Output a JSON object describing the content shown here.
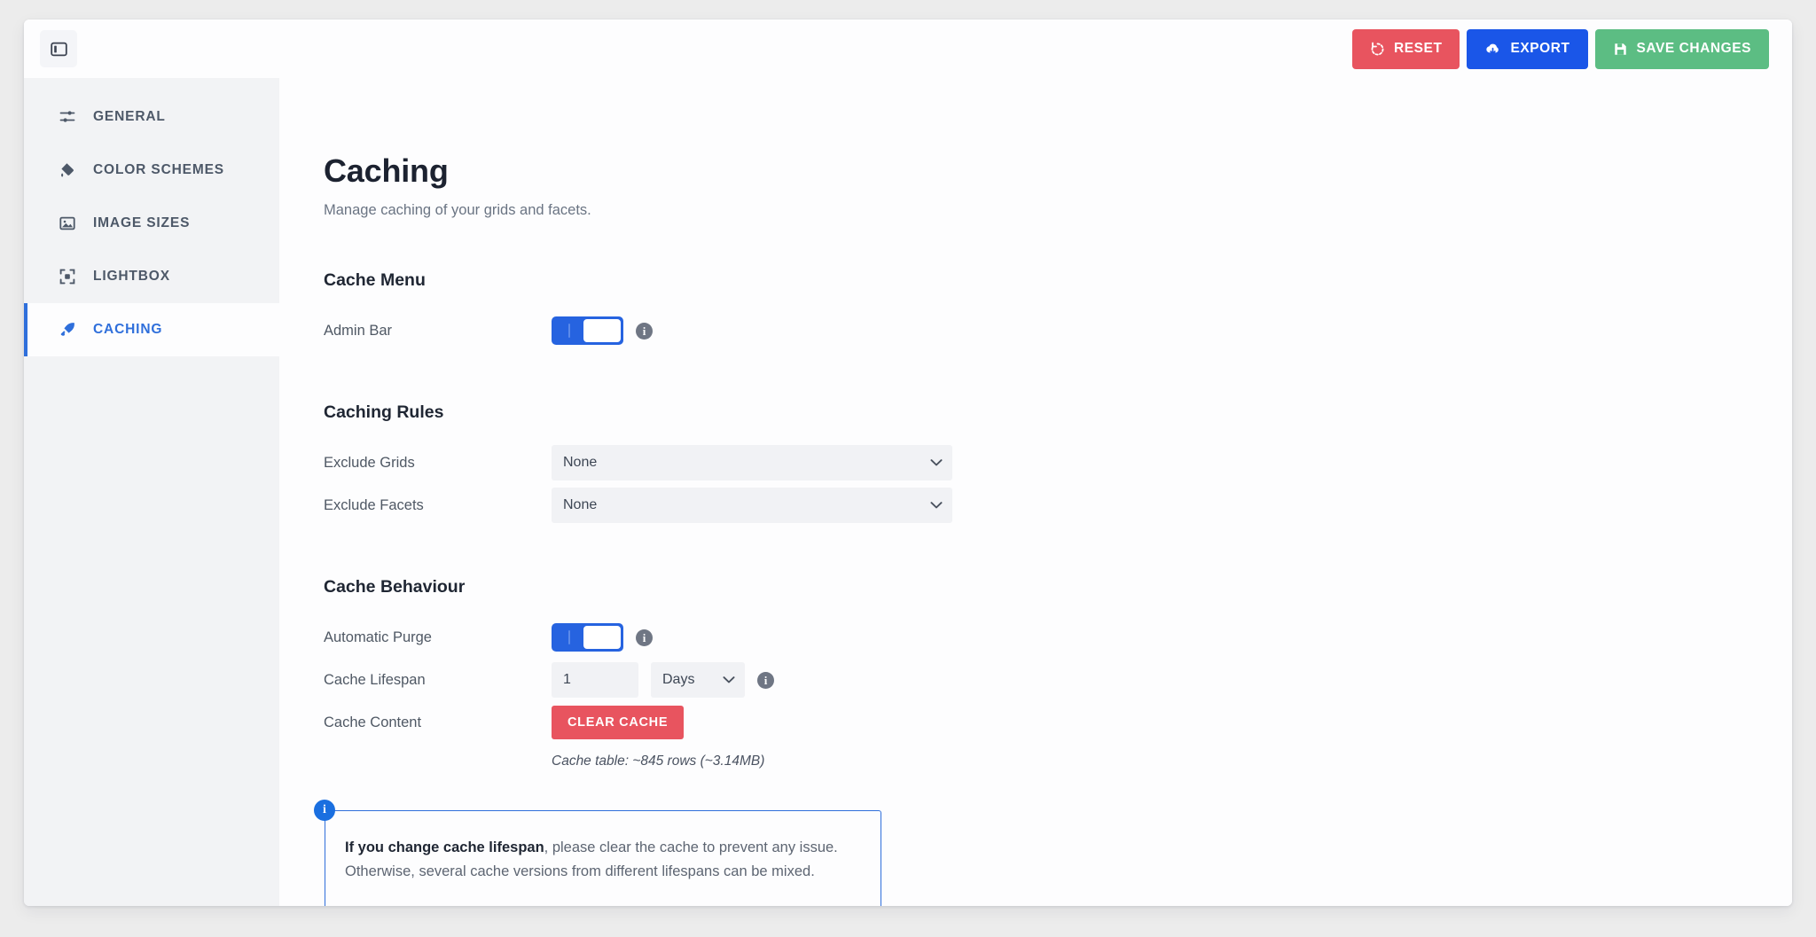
{
  "topbar": {
    "panel_toggle_icon": "sidebar-panel-icon",
    "buttons": [
      {
        "label": "RESET",
        "icon": "rotate-ccw-icon",
        "color": "#e8545f"
      },
      {
        "label": "EXPORT",
        "icon": "cloud-download-icon",
        "color": "#1a56e8"
      },
      {
        "label": "SAVE CHANGES",
        "icon": "floppy-save-icon",
        "color": "#5cbd83"
      }
    ]
  },
  "sidebar": {
    "items": [
      {
        "label": "GENERAL",
        "icon": "sliders-icon",
        "active": false
      },
      {
        "label": "COLOR SCHEMES",
        "icon": "paint-bucket-icon",
        "active": false
      },
      {
        "label": "IMAGE SIZES",
        "icon": "image-icon",
        "active": false
      },
      {
        "label": "LIGHTBOX",
        "icon": "expand-frame-icon",
        "active": false
      },
      {
        "label": "CACHING",
        "icon": "rocket-icon",
        "active": true
      }
    ],
    "active_color": "#2f6fdb"
  },
  "page": {
    "title": "Caching",
    "subtitle": "Manage caching of your grids and facets."
  },
  "sections": {
    "cache_menu": {
      "heading": "Cache Menu",
      "admin_bar": {
        "label": "Admin Bar",
        "toggle_state": "on",
        "info_icon": "info-icon"
      }
    },
    "caching_rules": {
      "heading": "Caching Rules",
      "exclude_grids": {
        "label": "Exclude Grids",
        "value": "None"
      },
      "exclude_facets": {
        "label": "Exclude Facets",
        "value": "None"
      }
    },
    "cache_behaviour": {
      "heading": "Cache Behaviour",
      "automatic_purge": {
        "label": "Automatic Purge",
        "toggle_state": "on"
      },
      "cache_lifespan": {
        "label": "Cache Lifespan",
        "value": "1",
        "unit": "Days"
      },
      "cache_content": {
        "label": "Cache Content",
        "button_label": "CLEAR CACHE",
        "meta": "Cache table: ~845 rows (~3.14MB)"
      }
    }
  },
  "notice": {
    "badge": "i",
    "bold_text": "If you change cache lifespan",
    "rest_text": ", please clear the cache to prevent any issue. Otherwise, several cache versions from different lifespans can be mixed.",
    "border_color": "#2f6fdb"
  }
}
